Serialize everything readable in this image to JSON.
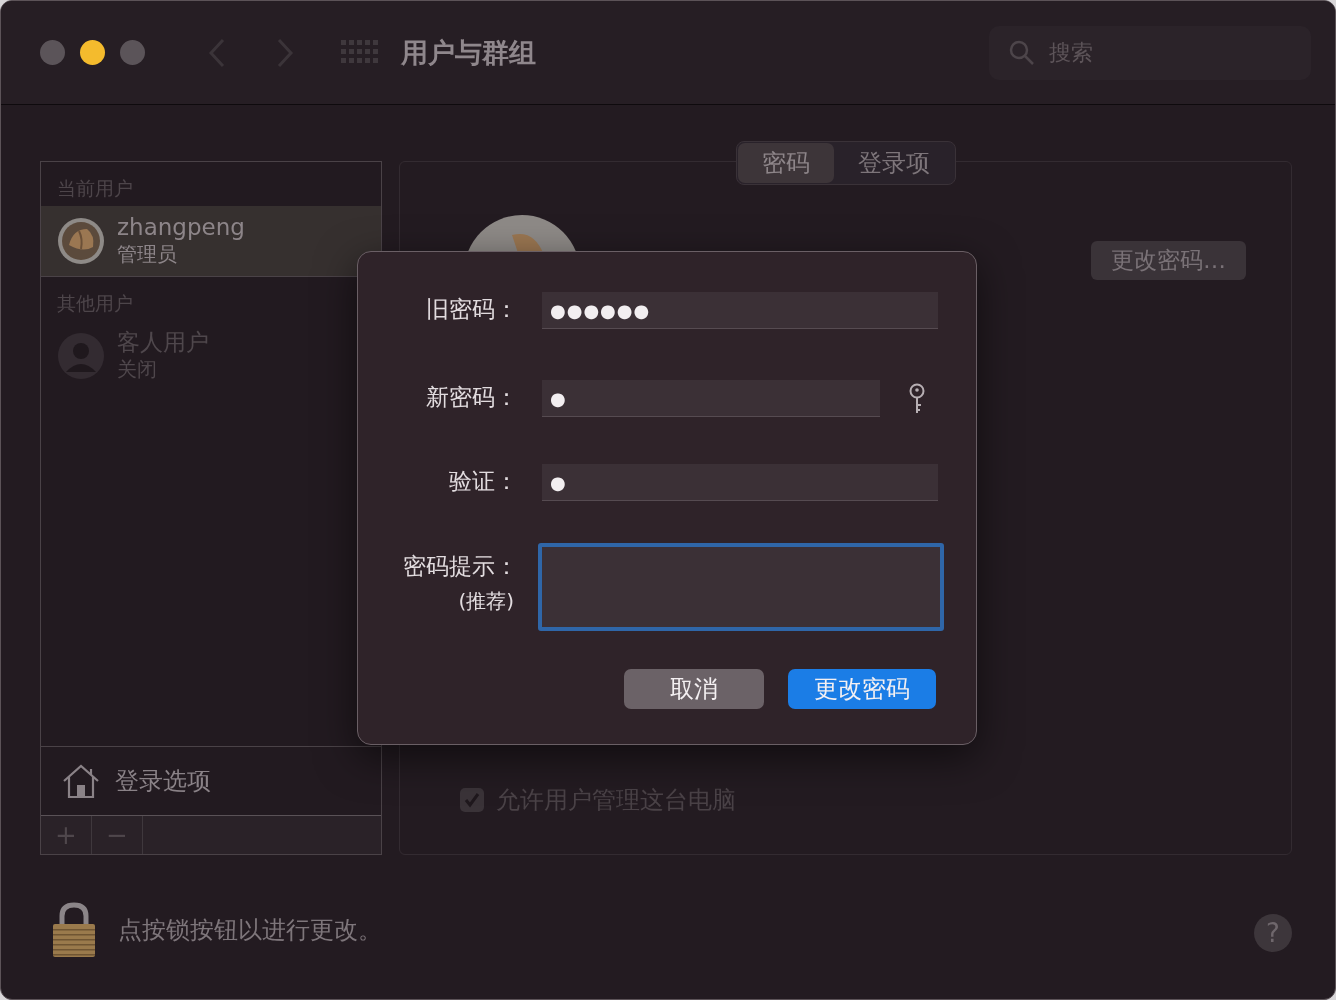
{
  "window": {
    "title": "用户与群组"
  },
  "search": {
    "placeholder": "搜索"
  },
  "sidebar": {
    "sections": [
      {
        "header": "当前用户",
        "users": [
          {
            "name": "zhangpeng",
            "role": "管理员",
            "selected": true,
            "kind": "photo"
          }
        ]
      },
      {
        "header": "其他用户",
        "users": [
          {
            "name": "客人用户",
            "role": "关闭",
            "selected": false,
            "kind": "silhouette"
          }
        ]
      }
    ],
    "login_options": "登录选项",
    "buttons": [
      "+",
      "−"
    ]
  },
  "tabs": [
    {
      "label": "密码",
      "selected": true
    },
    {
      "label": "登录项",
      "selected": false
    }
  ],
  "change_password_button": "更改密码…",
  "admin_checkbox": {
    "label": "允许用户管理这台电脑",
    "checked": true
  },
  "lock_message": "点按锁按钮以进行更改。",
  "help_button": "?",
  "dialog": {
    "fields": [
      {
        "label": "旧密码：",
        "value": "●●●●●●",
        "kind": "secure"
      },
      {
        "label": "新密码：",
        "value": "●",
        "kind": "secure",
        "assistant": true
      },
      {
        "label": "验证：",
        "value": "●",
        "kind": "secure"
      },
      {
        "label": "密码提示：",
        "note": "(推荐)",
        "kind": "text",
        "focused": true
      }
    ],
    "buttons": [
      {
        "label": "取消",
        "kind": "cancel"
      },
      {
        "label": "更改密码",
        "kind": "default"
      }
    ]
  }
}
